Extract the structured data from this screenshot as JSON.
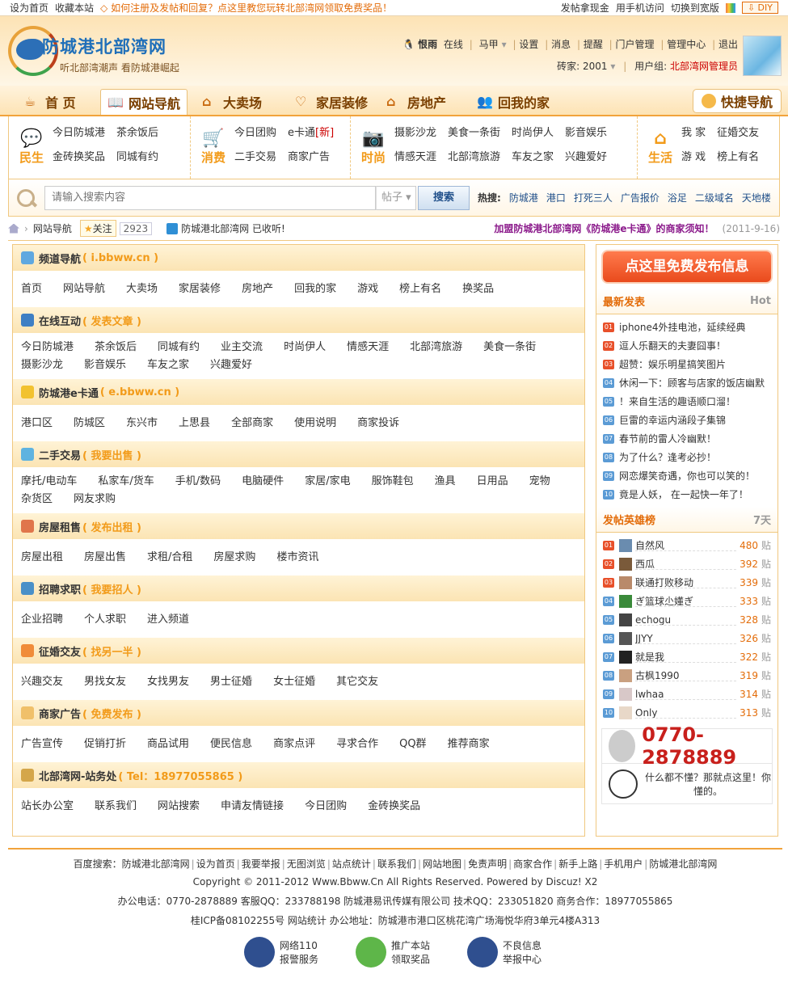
{
  "topbar": {
    "set_home": "设为首页",
    "bookmark": "收藏本站",
    "promo": "◇ 如何注册及发帖和回复？点这里教您玩转北部湾网领取免费奖品！",
    "post_cash": "发帖拿现金",
    "mobile": "用手机访问",
    "wide": "切换到宽版",
    "diy": "⇩ DIY"
  },
  "header": {
    "site_name": "防城港北部湾网",
    "slogan": "听北部湾潮声  看防城港崛起",
    "user": {
      "name": "恨雨",
      "status": "在线",
      "horse": "马甲",
      "links": [
        "设置",
        "消息",
        "提醒",
        "门户管理",
        "管理中心",
        "退出"
      ],
      "bricks_label": "砖家: 2001",
      "group_label": "用户组:",
      "group": "北部湾网管理员"
    }
  },
  "nav": {
    "items": [
      {
        "label": "首 页",
        "icon": "teacup-icon"
      },
      {
        "label": "网站导航",
        "icon": "book-icon"
      },
      {
        "label": "大卖场",
        "icon": "basket-icon"
      },
      {
        "label": "家居装修",
        "icon": "heart-icon"
      },
      {
        "label": "房地产",
        "icon": "house-icon"
      },
      {
        "label": "回我的家",
        "icon": "people-icon"
      }
    ],
    "quick": "快捷导航"
  },
  "categories": [
    {
      "title": "民生",
      "icon": "speech-bubble-icon",
      "links": [
        "今日防城港",
        "金砖换奖品",
        "茶余饭后",
        "同城有约"
      ]
    },
    {
      "title": "消费",
      "icon": "cart-icon",
      "links": [
        "今日团购",
        "二手交易",
        "e卡通",
        "商家广告"
      ],
      "new_tag": "[新]"
    },
    {
      "title": "时尚",
      "icon": "camera-icon",
      "links": [
        "摄影沙龙",
        "情感天涯",
        "美食一条街",
        "北部湾旅游",
        "时尚伊人",
        "车友之家",
        "影音娱乐",
        "兴趣爱好"
      ]
    },
    {
      "title": "生活",
      "icon": "home-icon",
      "links": [
        "我 家",
        "游 戏",
        "征婚交友",
        "榜上有名"
      ]
    }
  ],
  "search": {
    "placeholder": "请输入搜索内容",
    "scope": "帖子",
    "button": "搜索",
    "hot_label": "热搜:",
    "hot": [
      "防城港",
      "港口",
      "打死三人",
      "广告报价",
      "浴足",
      "二级域名",
      "天地楼"
    ]
  },
  "crumb": {
    "section": "网站导航",
    "follow": "关注",
    "count": "2923",
    "collected": "防城港北部湾网 已收听!",
    "notice": "加盟防城港北部湾网《防城港e卡通》的商家须知！",
    "date": "(2011-9-16)"
  },
  "sections": [
    {
      "title": "频道导航",
      "action": "( i.bbww.cn )",
      "color": "#5fa8e0",
      "links": [
        "首页",
        "网站导航",
        "大卖场",
        "家居装修",
        "房地产",
        "回我的家",
        "游戏",
        "榜上有名",
        "换奖品"
      ]
    },
    {
      "title": "在线互动",
      "action": "( 发表文章 )",
      "color": "#3e7fc4",
      "links": [
        "今日防城港",
        "茶余饭后",
        "同城有约",
        "业主交流",
        "时尚伊人",
        "情感天涯",
        "北部湾旅游",
        "美食一条街",
        "摄影沙龙",
        "影音娱乐",
        "车友之家",
        "兴趣爱好"
      ]
    },
    {
      "title": "防城港e卡通",
      "action": "( e.bbww.cn )",
      "color": "#f2c230",
      "links": [
        "港口区",
        "防城区",
        "东兴市",
        "上思县",
        "全部商家",
        "使用说明",
        "商家投诉"
      ]
    },
    {
      "title": "二手交易",
      "action": "( 我要出售 )",
      "color": "#5fb3e0",
      "links": [
        "摩托/电动车",
        "私家车/货车",
        "手机/数码",
        "电脑硬件",
        "家居/家电",
        "服饰鞋包",
        "渔具",
        "日用品",
        "宠物",
        "杂货区",
        "网友求购"
      ]
    },
    {
      "title": "房屋租售",
      "action": "( 发布出租 )",
      "color": "#e0754b",
      "links": [
        "房屋出租",
        "房屋出售",
        "求租/合租",
        "房屋求购",
        "楼市资讯"
      ]
    },
    {
      "title": "招聘求职",
      "action": "( 我要招人 )",
      "color": "#4a90c8",
      "links": [
        "企业招聘",
        "个人求职",
        "进入频道"
      ]
    },
    {
      "title": "征婚交友",
      "action": "( 找另一半 )",
      "color": "#f08c3a",
      "links": [
        "兴趣交友",
        "男找女友",
        "女找男友",
        "男士征婚",
        "女士征婚",
        "其它交友"
      ]
    },
    {
      "title": "商家广告",
      "action": "( 免费发布 )",
      "color": "#f0c06a",
      "links": [
        "广告宣传",
        "促销打折",
        "商品试用",
        "便民信息",
        "商家点评",
        "寻求合作",
        "QQ群",
        "推荐商家"
      ]
    },
    {
      "title": "北部湾网-站务处",
      "action": "( Tel：18977055865 )",
      "color": "#d4a64a",
      "links": [
        "站长办公室",
        "联系我们",
        "网站搜索",
        "申请友情链接",
        "今日团购",
        "金砖换奖品"
      ]
    }
  ],
  "sidebar": {
    "post_button": "点这里免费发布信息",
    "latest_title": "最新发表",
    "latest_tag": "Hot",
    "latest": [
      "iphone4外挂电池，延续经典",
      "逗人乐翻天的夫妻囧事！",
      "超赞：娱乐明星搞笑图片",
      "休闲一下：顾客与店家的饭店幽默",
      "！来自生活的趣语顺口溜！",
      "巨雷的幸运内涵段子集锦",
      "春节前的雷人冷幽默！",
      "为了什么？逢考必抄！",
      "网恋爆笑奇遇，你也可以笑的！",
      "竟是人妖， 在一起快一年了！"
    ],
    "latest_nums": [
      "01",
      "02",
      "03",
      "04",
      "05",
      "06",
      "07",
      "08",
      "09",
      "10"
    ],
    "rank_title": "发帖英雄榜",
    "rank_tag": "7天",
    "rank_unit": "贴",
    "rank": [
      {
        "name": "自然风",
        "count": "480"
      },
      {
        "name": "西瓜",
        "count": "392"
      },
      {
        "name": "联通打败移动",
        "count": "339"
      },
      {
        "name": "ぎ篮球尐嬞ぎ",
        "count": "333"
      },
      {
        "name": "echogu",
        "count": "328"
      },
      {
        "name": "JJYY",
        "count": "326"
      },
      {
        "name": "就是我",
        "count": "322"
      },
      {
        "name": "古枫1990",
        "count": "319"
      },
      {
        "name": "lwhaa",
        "count": "314"
      },
      {
        "name": "Only",
        "count": "313"
      }
    ],
    "phone": "0770-2878889",
    "help": "什么都不懂？那就点这里！你懂的。"
  },
  "footer": {
    "links": [
      "百度搜索：防城港北部湾网",
      "设为首页",
      "我要举报",
      "无图浏览",
      "站点统计",
      "联系我们",
      "网站地图",
      "免责声明",
      "商家合作",
      "新手上路",
      "手机用户",
      "防城港北部湾网"
    ],
    "copyright": "Copyright © 2011-2012 Www.Bbww.Cn All Rights Reserved. Powered by Discuz! X2",
    "contact": "办公电话：0770-2878889  客服QQ：233788198  防城港易讯传媒有限公司  技术QQ：233051820  商务合作：18977055865",
    "icp": "桂ICP备08102255号  网站统计  办公地址：防城港市港口区桃花湾广场海悦华府3单元4楼A313",
    "badges": [
      "网络110 报警服务",
      "推广本站 领取奖品",
      "不良信息 举报中心"
    ]
  }
}
